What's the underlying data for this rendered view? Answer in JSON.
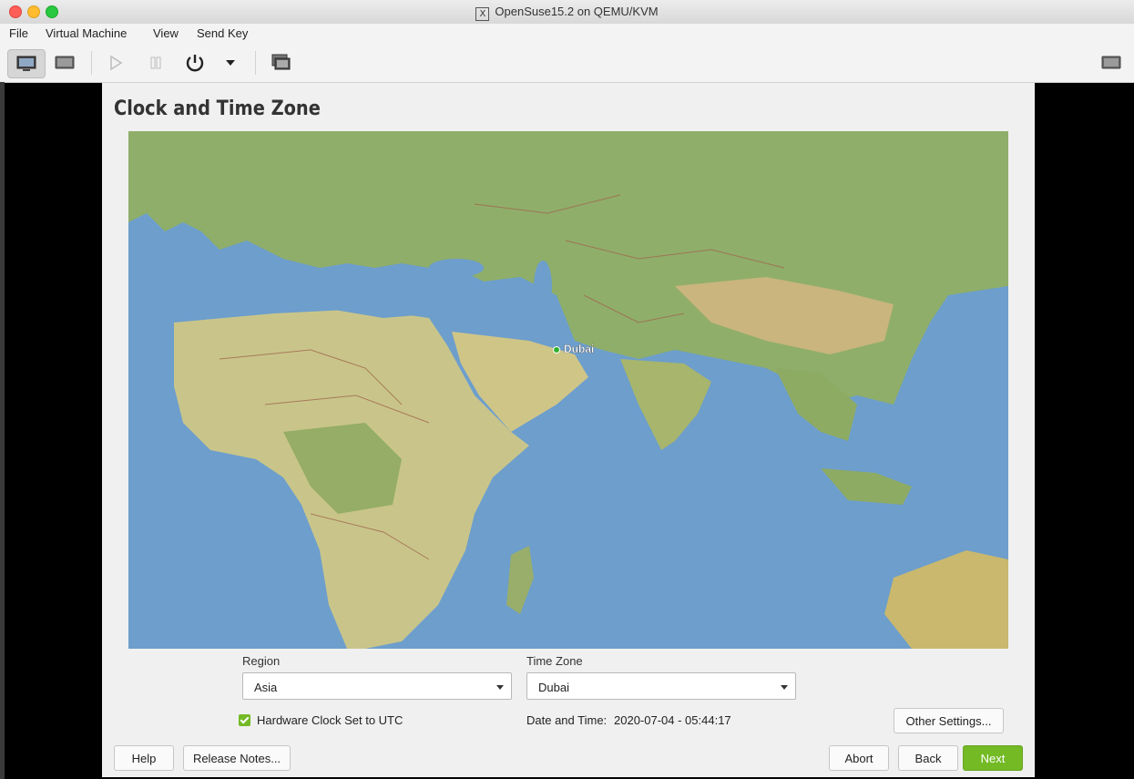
{
  "window": {
    "title": "OpenSuse15.2 on QEMU/KVM"
  },
  "menu": [
    "File",
    "Virtual Machine",
    "View",
    "Send Key"
  ],
  "toolbar": {
    "icons": [
      "console-icon",
      "details-icon",
      "run-icon",
      "pause-icon",
      "power-icon",
      "dropdown-icon",
      "snapshots-icon",
      "fullscreen-icon"
    ]
  },
  "installer": {
    "title": "Clock and Time Zone",
    "map": {
      "selected_city": "Dubai"
    },
    "region": {
      "label": "Region",
      "value": "Asia"
    },
    "timezone": {
      "label": "Time Zone",
      "value": "Dubai"
    },
    "hw_clock": {
      "label": "Hardware Clock Set to UTC",
      "checked": true
    },
    "datetime": {
      "label": "Date and Time:",
      "value": "2020-07-04 - 05:44:17"
    },
    "buttons": {
      "other_settings": "Other Settings...",
      "help": "Help",
      "release_notes": "Release Notes...",
      "abort": "Abort",
      "back": "Back",
      "next": "Next"
    }
  },
  "colors": {
    "accent": "#73ba25",
    "ocean": "#6d9ecc",
    "land": "#c9c58a"
  }
}
